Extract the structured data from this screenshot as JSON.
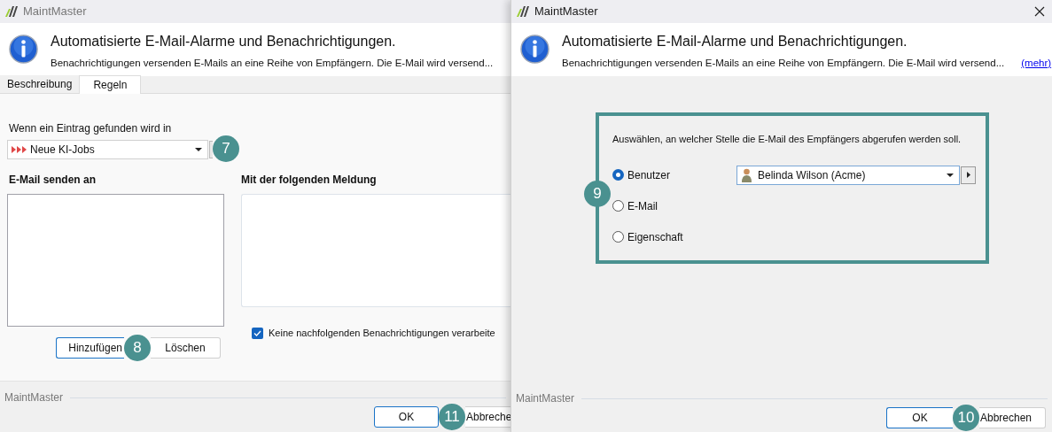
{
  "left_window": {
    "title": "MaintMaster",
    "header": {
      "title": "Automatisierte E-Mail-Alarme und Benachrichtigungen.",
      "description": "Benachrichtigungen versenden E-Mails an eine Reihe von Empfängern. Die E-Mail wird versend..."
    },
    "tabs": [
      {
        "label": "Beschreibung",
        "selected": false
      },
      {
        "label": "Regeln",
        "selected": true
      }
    ],
    "trigger": {
      "label": "Wenn ein Eintrag gefunden wird in",
      "value": "Neue KI-Jobs",
      "callout": "7"
    },
    "recipients": {
      "label": "E-Mail senden an",
      "buttons": [
        "Hinzufügen",
        "Löschen"
      ],
      "callout": "8"
    },
    "message": {
      "label": "Mit der folgenden Meldung"
    },
    "checkbox": {
      "label": "Keine nachfolgenden Benachrichtigungen verarbeite",
      "checked": true
    },
    "footer": {
      "brand": "MaintMaster",
      "buttons": [
        "OK",
        "Abbreche"
      ],
      "callout": "11"
    }
  },
  "right_window": {
    "title": "MaintMaster",
    "header": {
      "title": "Automatisierte E-Mail-Alarme und Benachrichtigungen.",
      "description": "Benachrichtigungen versenden E-Mails an eine Reihe von Empfängern. Die E-Mail wird versend...",
      "more_link": "(mehr)"
    },
    "prompt": "Auswählen, an welcher Stelle die E-Mail des Empfängers abgerufen werden soll.",
    "options": [
      {
        "label": "Benutzer",
        "selected": true
      },
      {
        "label": "E-Mail",
        "selected": false
      },
      {
        "label": "Eigenschaft",
        "selected": false
      }
    ],
    "user_select": {
      "value": "Belinda Wilson (Acme)"
    },
    "callout": "9",
    "footer": {
      "brand": "MaintMaster",
      "buttons": [
        "OK",
        "Abbrechen"
      ],
      "callout": "10"
    }
  }
}
